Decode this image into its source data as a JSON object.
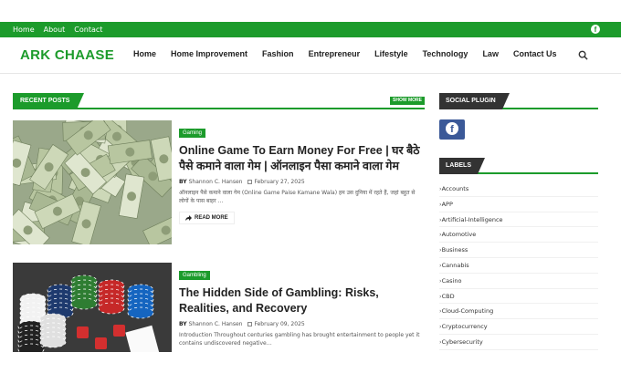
{
  "topbar": {
    "links": [
      "Home",
      "About",
      "Contact"
    ],
    "social_icon": "facebook-icon"
  },
  "header": {
    "logo": "ARK CHAASE",
    "nav": [
      "Home",
      "Home Improvement",
      "Fashion",
      "Entrepreneur",
      "Lifestyle",
      "Technology",
      "Law",
      "Contact Us"
    ],
    "search_icon": "search-icon"
  },
  "recent_posts": {
    "title": "RECENT POSTS",
    "show_more": "SHOW MORE",
    "posts": [
      {
        "category": "Gaming",
        "title": "Online Game To Earn Money For Free | घर बैठे पैसे कमाने वाला गेम | ऑनलाइन पैसा कमाने वाला गेम",
        "author": "Shannon C. Hansen",
        "date": "February 27, 2025",
        "excerpt": "ऑनलाइन पैसे कमाने वाला गेम (Online Game Paise Kamane Wala) हम उस दुनिया में रहते हैं, जहां बहुत से लोगों के पास बाहर …",
        "read_more": "READ MORE",
        "image": "money-pile-image"
      },
      {
        "category": "Gambling",
        "title": "The Hidden Side of Gambling: Risks, Realities, and Recovery",
        "author": "Shannon C. Hansen",
        "date": "February 09, 2025",
        "excerpt": "Introduction  Throughout centuries gambling has brought entertainment to people yet it contains undiscovered negative…",
        "image": "casino-chips-image"
      }
    ],
    "by_label": "BY"
  },
  "sidebar": {
    "social_title": "SOCIAL PLUGIN",
    "labels_title": "LABELS",
    "labels": [
      "Accounts",
      "APP",
      "Artificial-Intelligence",
      "Automotive",
      "Business",
      "Cannabis",
      "Casino",
      "CBD",
      "Cloud-Computing",
      "Cryptocurrency",
      "Cybersecurity"
    ]
  },
  "colors": {
    "accent": "#1c9b2b",
    "dark": "#333333",
    "facebook": "#3b5998"
  }
}
